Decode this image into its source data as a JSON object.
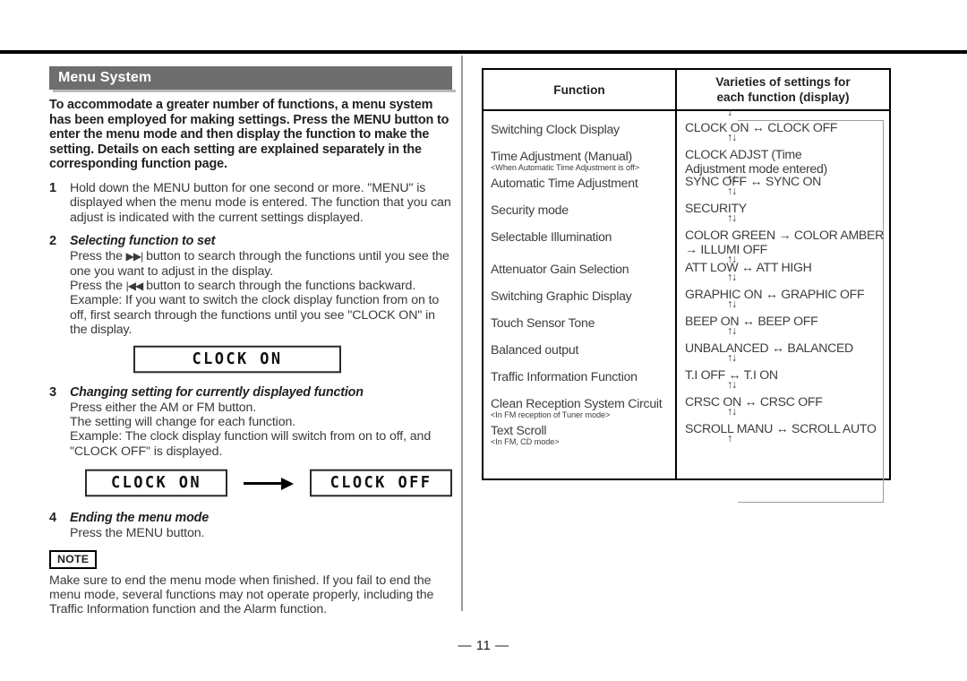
{
  "page": {
    "number_label": "— 11 —"
  },
  "left": {
    "section_title": "Menu System",
    "intro": "To accommodate a greater number of functions, a menu system has been employed for making settings.  Press the MENU button to enter the menu mode and then display the function to make the setting.  Details on each setting are explained separately in the corresponding function page.",
    "steps": [
      {
        "num": "1",
        "title": "",
        "body": "Hold down the MENU button for one second or more. \"MENU\" is displayed when the menu mode is entered. The function that you can adjust is indicated with the current settings displayed."
      },
      {
        "num": "2",
        "title": "Selecting function to set",
        "body_line1": "Press the ",
        "fwd_glyph": "▶▶|",
        "body_line1b": " button to search through the functions until you see the one you want to adjust in the display.",
        "body_line2": "Press the ",
        "rew_glyph": "|◀◀",
        "body_line2b": " button to search through the functions backward.",
        "example_label": "Example:",
        "example_text": "If you want to switch the clock display function from on to off, first search through the functions until you see \"CLOCK ON\" in the display."
      },
      {
        "num": "3",
        "title": "Changing setting for currently displayed function",
        "body_line1": "Press either the AM or FM button.",
        "body_line2": "The setting will change for each function.",
        "example_label": "Example:",
        "example_text": "The clock display function will switch from on to off, and \"CLOCK OFF\" is displayed."
      },
      {
        "num": "4",
        "title": "Ending the menu mode",
        "body": "Press the MENU button."
      }
    ],
    "lcd": {
      "step2_display": "CLOCK ON",
      "step3_before": "CLOCK ON",
      "step3_after": "CLOCK OFF"
    },
    "note": {
      "badge": "NOTE",
      "text": "Make sure to end the menu mode when finished. If you fail to end the menu mode, several functions may not operate properly, including the Traffic Information function and the Alarm function."
    }
  },
  "table": {
    "headers": {
      "function": "Function",
      "settings_line1": "Varieties of settings for",
      "settings_line2": "each function (display)"
    },
    "top_arrow": "↓",
    "bottom_arrow": "↑",
    "separator_arrow": "↑↓",
    "rows": [
      {
        "function": "Switching Clock Display",
        "function_sub": "",
        "setting": "CLOCK ON ↔ CLOCK OFF",
        "setting_cont": ""
      },
      {
        "function": "Time Adjustment (Manual)",
        "function_sub": "<When Automatic Time Adjustment is off>",
        "setting": "CLOCK ADJST (Time",
        "setting_cont": "Adjustment mode entered)"
      },
      {
        "function": "Automatic Time Adjustment",
        "function_sub": "",
        "setting": "SYNC OFF ↔ SYNC ON",
        "setting_cont": ""
      },
      {
        "function": "Security mode",
        "function_sub": "",
        "setting": "SECURITY",
        "setting_cont": ""
      },
      {
        "function": "Selectable Illumination",
        "function_sub": "",
        "setting": "COLOR GREEN → COLOR AMBER",
        "setting_cont": "→ ILLUMI OFF"
      },
      {
        "function": "Attenuator Gain Selection",
        "function_sub": "",
        "setting": "ATT LOW ↔ ATT HIGH",
        "setting_cont": ""
      },
      {
        "function": "Switching Graphic Display",
        "function_sub": "",
        "setting": "GRAPHIC ON ↔ GRAPHIC OFF",
        "setting_cont": ""
      },
      {
        "function": "Touch Sensor Tone",
        "function_sub": "",
        "setting": "BEEP ON ↔ BEEP OFF",
        "setting_cont": ""
      },
      {
        "function": "Balanced output",
        "function_sub": "",
        "setting": "UNBALANCED ↔ BALANCED",
        "setting_cont": ""
      },
      {
        "function": "Traffic Information Function",
        "function_sub": "",
        "setting": "T.I OFF ↔ T.I ON",
        "setting_cont": ""
      },
      {
        "function": "Clean Reception System Circuit",
        "function_sub": "<In FM reception of Tuner mode>",
        "setting": "CRSC ON ↔ CRSC OFF",
        "setting_cont": ""
      },
      {
        "function": "Text Scroll",
        "function_sub": "<In FM, CD mode>",
        "setting": "SCROLL MANU ↔ SCROLL AUTO",
        "setting_cont": ""
      }
    ]
  }
}
